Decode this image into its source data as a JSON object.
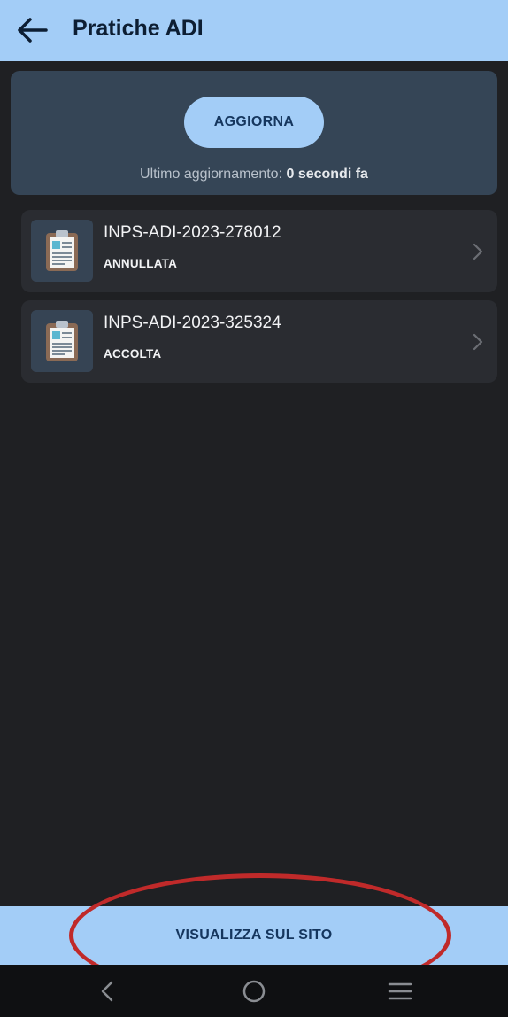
{
  "app_bar": {
    "back_icon": "arrow-left-icon",
    "title": "Pratiche ADI"
  },
  "update_card": {
    "button_label": "AGGIORNA",
    "status_prefix": "Ultimo aggiornamento: ",
    "status_value": "0 secondi fa"
  },
  "practices": [
    {
      "code": "INPS-ADI-2023-278012",
      "status": "ANNULLATA",
      "icon": "clipboard-document-icon"
    },
    {
      "code": "INPS-ADI-2023-325324",
      "status": "ACCOLTA",
      "icon": "clipboard-document-icon"
    }
  ],
  "bottom_action": {
    "label": "VISUALIZZA SUL SITO"
  },
  "system_nav": {
    "back_icon": "nav-back-icon",
    "home_icon": "nav-home-icon",
    "recents_icon": "nav-recents-icon"
  },
  "colors": {
    "background": "#1f2023",
    "accent": "#a3cdf7",
    "card": "#354556",
    "list_item": "#2a2c31",
    "highlight_annotation": "#c02a2a"
  }
}
